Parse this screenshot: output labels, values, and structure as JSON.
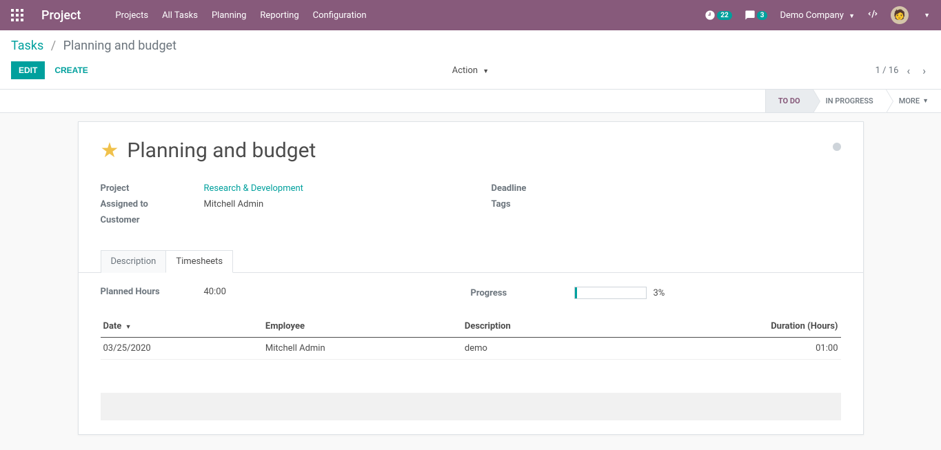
{
  "topnav": {
    "brand": "Project",
    "items": [
      "Projects",
      "All Tasks",
      "Planning",
      "Reporting",
      "Configuration"
    ],
    "activity_count": "22",
    "chat_count": "3",
    "company": "Demo Company"
  },
  "breadcrumb": {
    "root": "Tasks",
    "current": "Planning and budget"
  },
  "buttons": {
    "edit": "EDIT",
    "create": "CREATE",
    "action": "Action"
  },
  "pager": {
    "position": "1 / 16"
  },
  "status": {
    "todo": "TO DO",
    "in_progress": "IN PROGRESS",
    "more": "MORE"
  },
  "task": {
    "title": "Planning and budget",
    "labels": {
      "project": "Project",
      "assigned_to": "Assigned to",
      "customer": "Customer",
      "deadline": "Deadline",
      "tags": "Tags"
    },
    "project": "Research & Development",
    "assigned_to": "Mitchell Admin",
    "customer": "",
    "deadline": "",
    "tags": ""
  },
  "tabs": {
    "description": "Description",
    "timesheets": "Timesheets"
  },
  "timesheet": {
    "planned_label": "Planned Hours",
    "planned_value": "40:00",
    "progress_label": "Progress",
    "progress_pct": "3%",
    "columns": {
      "date": "Date",
      "employee": "Employee",
      "description": "Description",
      "duration": "Duration (Hours)"
    },
    "rows": [
      {
        "date": "03/25/2020",
        "employee": "Mitchell Admin",
        "description": "demo",
        "duration": "01:00"
      }
    ]
  }
}
